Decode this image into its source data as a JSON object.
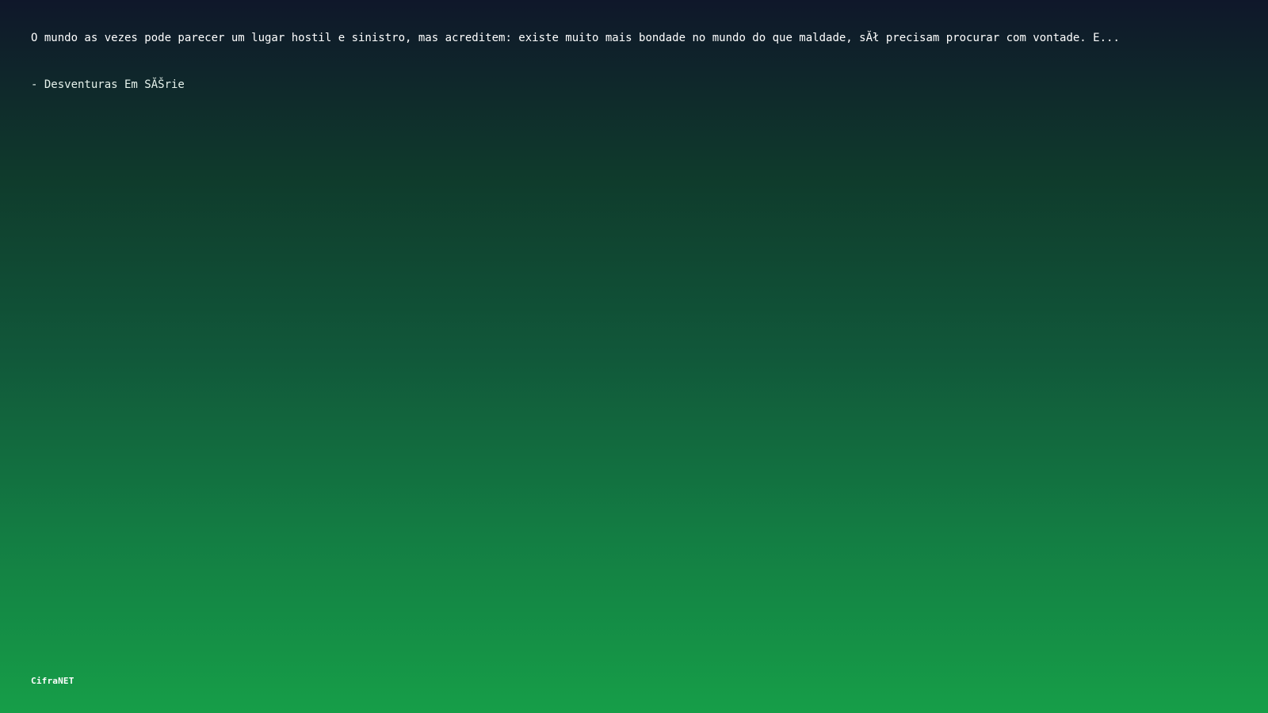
{
  "quote": {
    "text": "O mundo as vezes pode parecer um lugar hostil e sinistro, mas acreditem: existe muito mais bondade no mundo do que maldade, sĂł precisam procurar com vontade. E...",
    "author": "- Desventuras Em SĂŠrie"
  },
  "brand": {
    "name": "CifraNET"
  },
  "colors": {
    "background_top": "#0f172a",
    "background_bottom": "#169e48",
    "text": "#ffffff"
  }
}
